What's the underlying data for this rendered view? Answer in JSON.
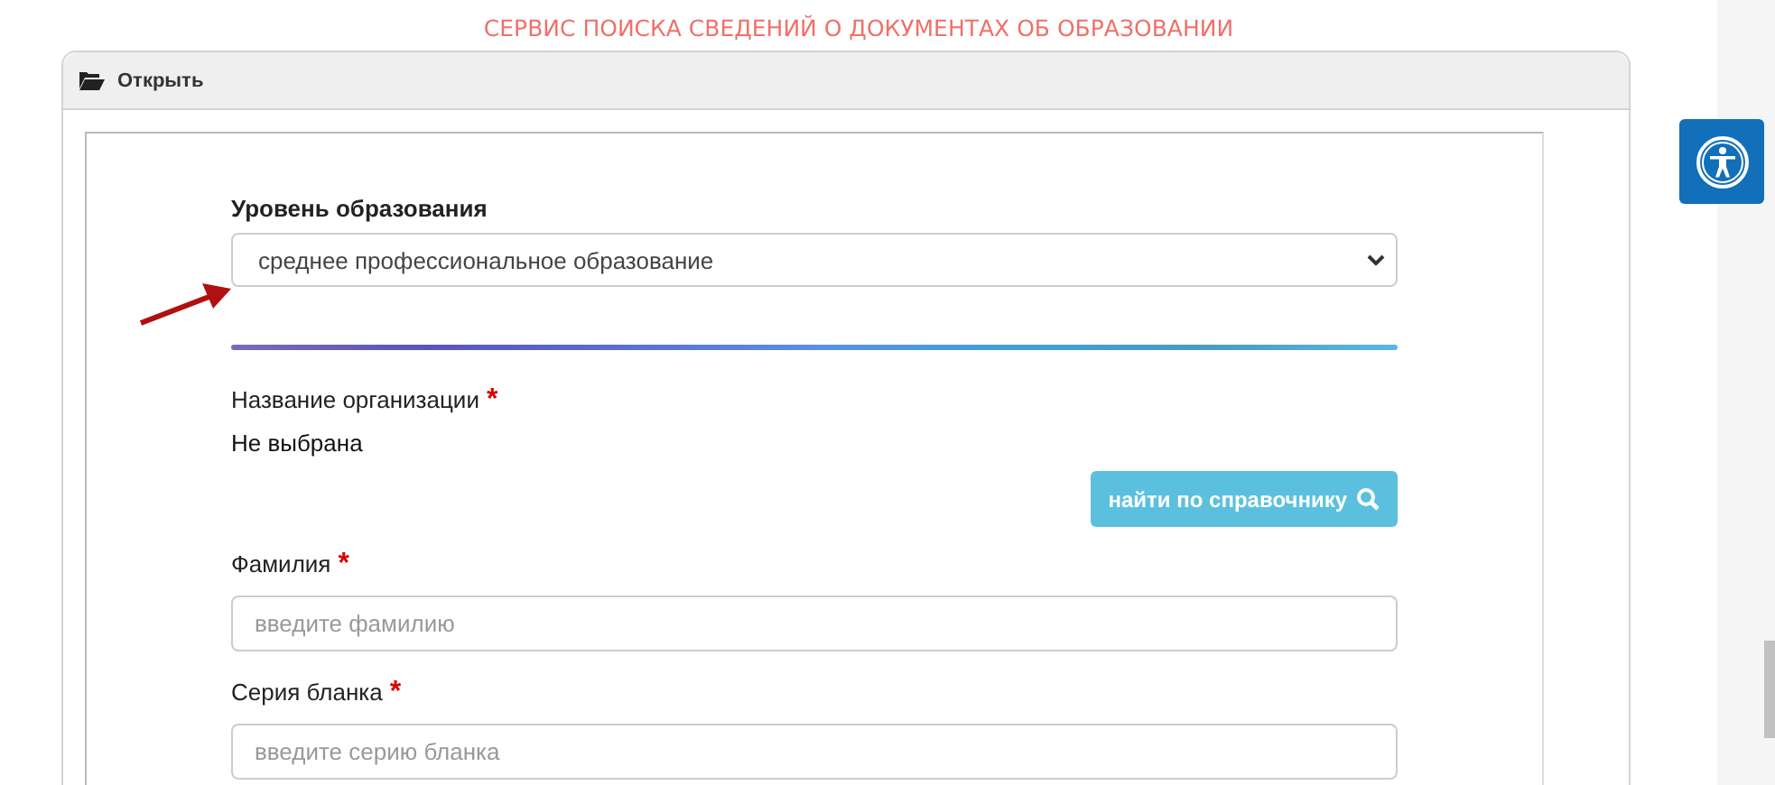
{
  "page_title": "СЕРВИС ПОИСКА СВЕДЕНИЙ О ДОКУМЕНТАХ ОБ ОБРАЗОВАНИИ",
  "panel": {
    "header": "Открыть"
  },
  "form": {
    "education_level": {
      "label": "Уровень образования",
      "value": "среднее профессиональное образование"
    },
    "organization": {
      "label": "Название организации",
      "required_mark": "*",
      "value": "Не выбрана"
    },
    "lookup_button": "найти по справочнику",
    "fields": [
      {
        "label": "Фамилия",
        "required_mark": "*",
        "placeholder": "введите фамилию"
      },
      {
        "label": "Серия бланка",
        "required_mark": "*",
        "placeholder": "введите серию бланка"
      }
    ]
  }
}
